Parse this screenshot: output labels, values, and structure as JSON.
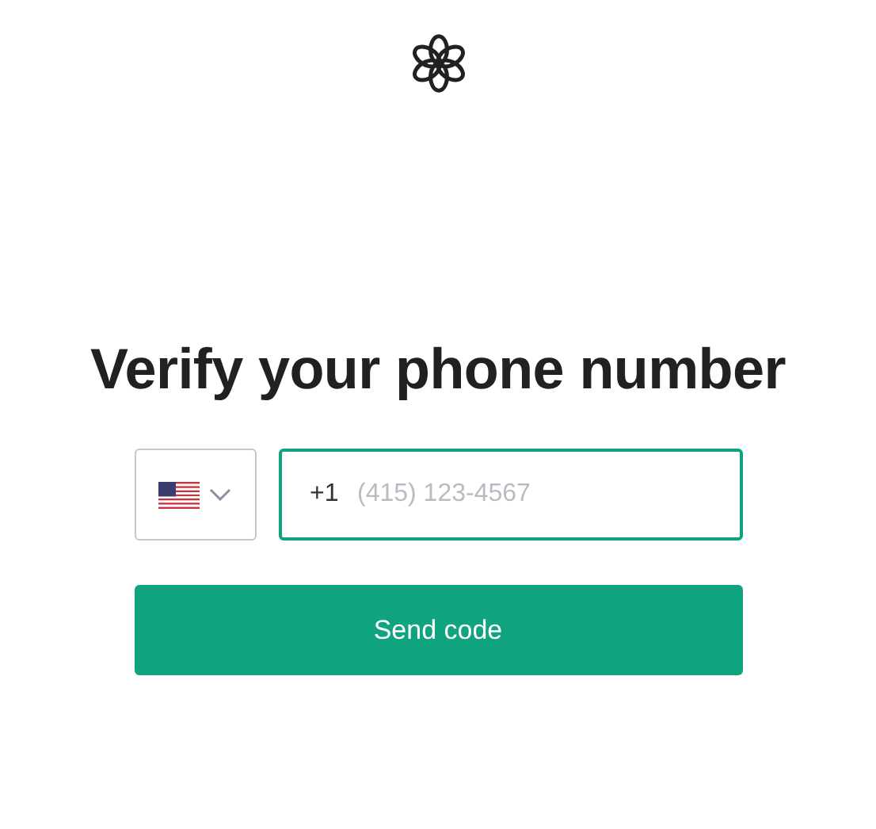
{
  "title": "Verify your phone number",
  "country_select": {
    "dial_code": "+1"
  },
  "phone_field": {
    "placeholder": "(415) 123-4567",
    "focused": true
  },
  "button": {
    "label": "Send code"
  }
}
